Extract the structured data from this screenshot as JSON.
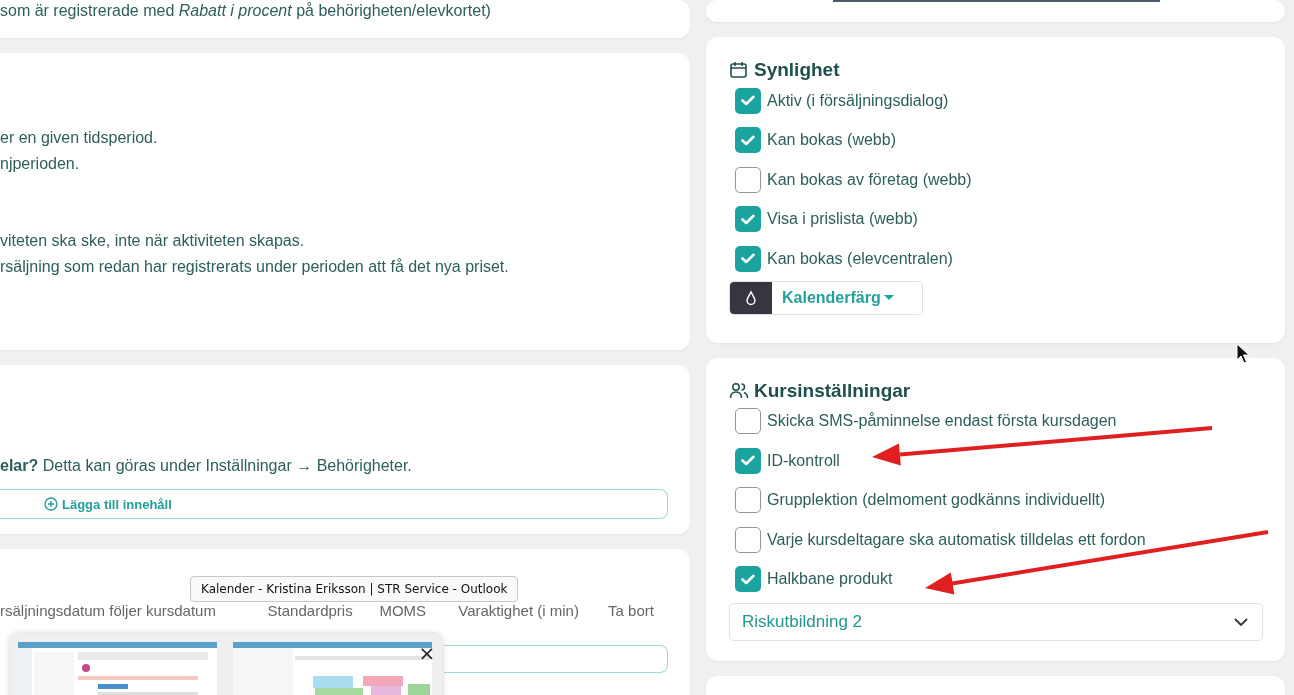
{
  "discount_card": {
    "note": "som är registrerade med *Rabatt i procent* på behörigheten/elevkortet)"
  },
  "price_period_card": {
    "paragraphs": [
      [
        "er en given tidsperiod.",
        "njperioden."
      ],
      [
        "viteten ska ske, inte när aktiviteten skapas.",
        "rsäljning som redan har registrerats under perioden att få det nya priset."
      ]
    ]
  },
  "permissions_card": {
    "note": "**elar?** Detta kan göras under Inställningar → Behörigheter.",
    "add_button": "Lägga till innehåll"
  },
  "price_table": {
    "columns": [
      "rsäljningsdatum följer kursdatum",
      "Standardpris",
      "MOMS",
      "Varaktighet (i min)",
      "Ta bort"
    ]
  },
  "visibility": {
    "title": "Synlighet",
    "items": [
      {
        "label": "Aktiv (i försäljningsdialog)",
        "checked": true
      },
      {
        "label": "Kan bokas (webb)",
        "checked": true
      },
      {
        "label": "Kan bokas av företag (webb)",
        "checked": false
      },
      {
        "label": "Visa i prislista (webb)",
        "checked": true
      },
      {
        "label": "Kan bokas (elevcentralen)",
        "checked": true
      }
    ],
    "color_button": "Kalenderfärg"
  },
  "course_settings": {
    "title": "Kursinställningar",
    "items": [
      {
        "label": "Skicka SMS-påminnelse endast första kursdagen",
        "checked": false
      },
      {
        "label": "ID-kontroll",
        "checked": true
      },
      {
        "label": "Grupplektion (delmoment godkänns individuellt)",
        "checked": false
      },
      {
        "label": "Varje kursdeltagare ska automatisk tilldelas ett fordon",
        "checked": false
      },
      {
        "label": "Halkbane produkt",
        "checked": true
      }
    ],
    "select_value": "Riskutbildning 2"
  },
  "taskbar_preview": {
    "tooltip": "Kalender - Kristina Eriksson | STR Service - Outlook",
    "close": "×"
  }
}
